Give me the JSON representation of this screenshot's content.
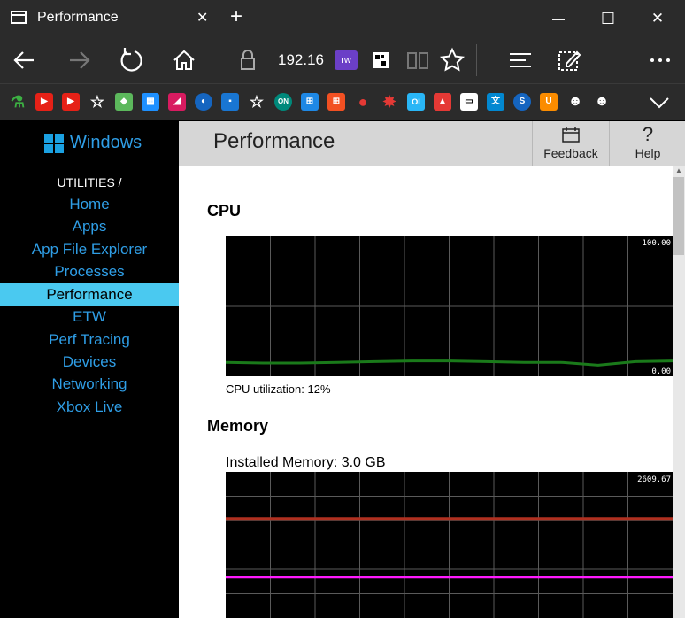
{
  "window": {
    "tab_title": "Performance",
    "new_tab": "+",
    "minimize": "—",
    "maximize": "☐",
    "close": "✕",
    "tab_close": "✕"
  },
  "navbar": {
    "address": "192.16",
    "rw_badge": "rw"
  },
  "sidebar": {
    "logo_text": "Windows",
    "section_label": "UTILITIES /",
    "items": [
      {
        "label": "Home"
      },
      {
        "label": "Apps"
      },
      {
        "label": "App File Explorer"
      },
      {
        "label": "Processes"
      },
      {
        "label": "Performance"
      },
      {
        "label": "ETW"
      },
      {
        "label": "Perf Tracing"
      },
      {
        "label": "Devices"
      },
      {
        "label": "Networking"
      },
      {
        "label": "Xbox Live"
      }
    ],
    "active_index": 4
  },
  "header": {
    "title": "Performance",
    "feedback_label": "Feedback",
    "help_label": "Help",
    "help_glyph": "?"
  },
  "cpu": {
    "title": "CPU",
    "max_label": "100.00",
    "min_label": "0.00",
    "caption": "CPU utilization: 12%",
    "line_color": "#1a7a1a",
    "values": [
      10,
      9.5,
      9.5,
      10,
      10.5,
      11,
      11,
      10.5,
      10,
      10,
      8,
      10.5,
      11
    ]
  },
  "memory": {
    "title": "Memory",
    "installed": "Installed Memory: 3.0 GB",
    "max_label": "2609.67",
    "series": [
      {
        "color": "#b03020",
        "level": 0.68
      },
      {
        "color": "#ff1aff",
        "level": 0.28
      }
    ]
  }
}
